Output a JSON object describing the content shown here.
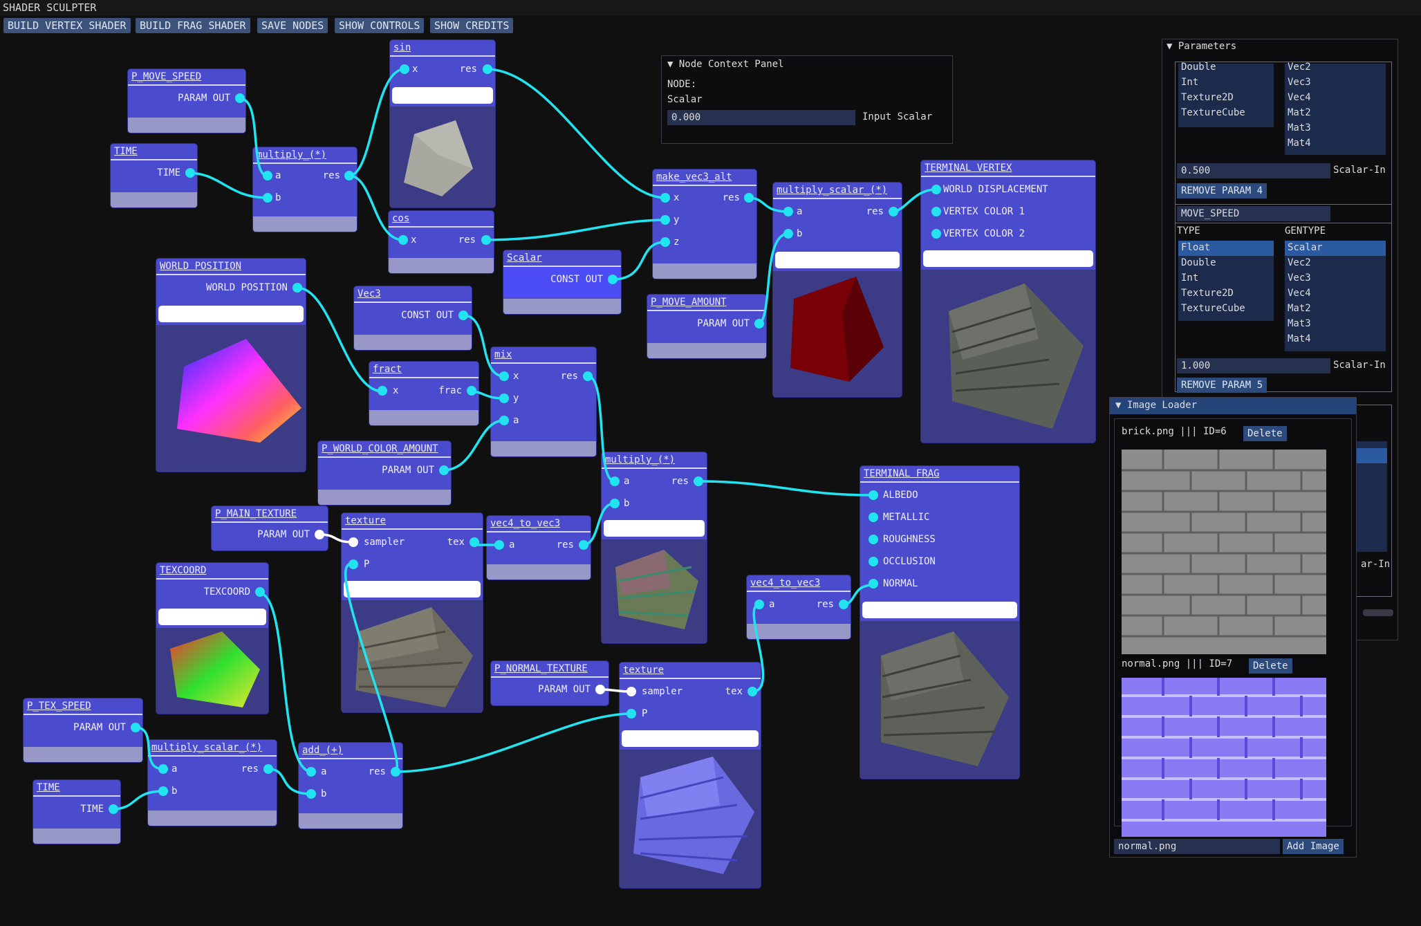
{
  "app_title": "SHADER SCULPTER",
  "menu": [
    "BUILD VERTEX SHADER",
    "BUILD FRAG SHADER",
    "SAVE NODES",
    "SHOW CONTROLS",
    "SHOW CREDITS"
  ],
  "colors": {
    "node": "#4b4bcd",
    "wire": "#22e4f0",
    "menu": "#3c527a",
    "background": "#101010"
  },
  "nodes": {
    "p_move_speed": {
      "title": "P_MOVE_SPEED",
      "out": "PARAM OUT"
    },
    "time_top": {
      "title": "TIME",
      "out": "TIME"
    },
    "multiply_top": {
      "title": "multiply_(*)",
      "in_a": "a",
      "in_b": "b",
      "out": "res"
    },
    "sin": {
      "title": "sin",
      "in_x": "x",
      "out": "res"
    },
    "cos": {
      "title": "cos",
      "in_x": "x",
      "out": "res"
    },
    "make_vec3_alt": {
      "title": "make_vec3_alt",
      "in_x": "x",
      "in_y": "y",
      "in_z": "z",
      "out": "res"
    },
    "scalar_const": {
      "title": "Scalar",
      "out": "CONST OUT"
    },
    "multiply_scalar_top": {
      "title": "multiply_scalar_(*)",
      "in_a": "a",
      "in_b": "b",
      "out": "res"
    },
    "p_move_amount": {
      "title": "P_MOVE_AMOUNT",
      "out": "PARAM OUT"
    },
    "terminal_vertex": {
      "title": "TERMINAL VERTEX",
      "in1": "WORLD DISPLACEMENT",
      "in2": "VERTEX COLOR 1",
      "in3": "VERTEX COLOR 2"
    },
    "world_position": {
      "title": "WORLD POSITION",
      "out": "WORLD POSITION"
    },
    "vec3_const": {
      "title": "Vec3",
      "out": "CONST OUT"
    },
    "fract": {
      "title": "fract",
      "in_x": "x",
      "out": "frac"
    },
    "mix": {
      "title": "mix",
      "in_x": "x",
      "in_y": "y",
      "in_a": "a",
      "out": "res"
    },
    "p_world_color_amount": {
      "title": "P_WORLD_COLOR_AMOUNT",
      "out": "PARAM OUT"
    },
    "multiply_mid": {
      "title": "multiply_(*)",
      "in_a": "a",
      "in_b": "b",
      "out": "res"
    },
    "p_main_texture": {
      "title": "P_MAIN_TEXTURE",
      "out": "PARAM OUT"
    },
    "texture_top": {
      "title": "texture",
      "in_sampler": "sampler",
      "in_p": "P",
      "out": "tex"
    },
    "vec4_to_vec3_a": {
      "title": "vec4_to_vec3",
      "in_a": "a",
      "out": "res"
    },
    "terminal_frag": {
      "title": "TERMINAL FRAG",
      "in1": "ALBEDO",
      "in2": "METALLIC",
      "in3": "ROUGHNESS",
      "in4": "OCCLUSION",
      "in5": "NORMAL"
    },
    "texcoord": {
      "title": "TEXCOORD",
      "out": "TEXCOORD"
    },
    "vec4_to_vec3_b": {
      "title": "vec4_to_vec3",
      "in_a": "a",
      "out": "res"
    },
    "p_normal_texture": {
      "title": "P_NORMAL_TEXTURE",
      "out": "PARAM OUT"
    },
    "texture_bottom": {
      "title": "texture",
      "in_sampler": "sampler",
      "in_p": "P",
      "out": "tex"
    },
    "p_tex_speed": {
      "title": "P_TEX_SPEED",
      "out": "PARAM OUT"
    },
    "multiply_scalar_bottom": {
      "title": "multiply_scalar_(*)",
      "in_a": "a",
      "in_b": "b",
      "out": "res"
    },
    "add": {
      "title": "add_(+)",
      "in_a": "a",
      "in_b": "b",
      "out": "res"
    },
    "time_bottom": {
      "title": "TIME",
      "out": "TIME"
    }
  },
  "node_context": {
    "header": "Node Context Panel",
    "node_label": "NODE:",
    "node_type": "Scalar",
    "value": "0.000",
    "input_label": "Input Scalar"
  },
  "parameters": {
    "header": "Parameters",
    "top_types": [
      "Double",
      "Int",
      "Texture2D",
      "TextureCube"
    ],
    "top_gentypes": [
      "Vec2",
      "Vec3",
      "Vec4",
      "Mat2",
      "Mat3",
      "Mat4"
    ],
    "param4_value": "0.500",
    "param4_label": "Scalar-In",
    "remove4": "REMOVE PARAM 4",
    "move_speed_name": "MOVE_SPEED",
    "type_label": "TYPE",
    "gentype_label": "GENTYPE",
    "types": [
      "Float",
      "Double",
      "Int",
      "Texture2D",
      "TextureCube"
    ],
    "gentypes": [
      "Scalar",
      "Vec2",
      "Vec3",
      "Vec4",
      "Mat2",
      "Mat3",
      "Mat4"
    ],
    "param5_value": "1.000",
    "param5_label": "Scalar-In",
    "remove5": "REMOVE PARAM 5",
    "partial_label": "ar-In"
  },
  "image_loader": {
    "header": "Image Loader",
    "img1_label": "brick.png ||| ID=6",
    "img2_label": "normal.png ||| ID=7",
    "delete": "Delete",
    "filename_value": "normal.png",
    "add_image": "Add Image"
  }
}
